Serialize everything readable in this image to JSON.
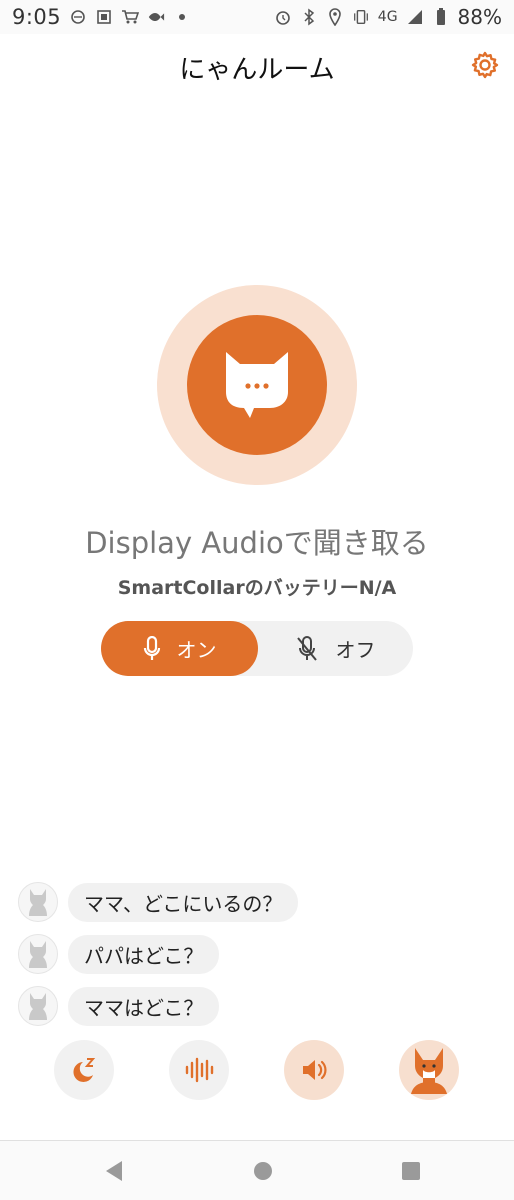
{
  "status_bar": {
    "time": "9:05",
    "network": "4G",
    "battery": "88%",
    "icons": [
      "notification-icon",
      "storage-icon",
      "cart-icon",
      "fish-icon",
      "dot-icon",
      "alarm-icon",
      "bluetooth-icon",
      "location-icon",
      "vibrate-icon",
      "signal-icon",
      "battery-icon"
    ]
  },
  "app_bar": {
    "title": "にゃんルーム",
    "settings_icon": "gear-icon"
  },
  "main": {
    "listen_title": "Display Audioで聞き取る",
    "battery_text": "SmartCollarのバッテリーN/A",
    "toggle": {
      "on_label": "オン",
      "off_label": "オフ",
      "selected": "on"
    }
  },
  "chat": {
    "messages": [
      {
        "text": "ママ、どこにいるの？"
      },
      {
        "text": "パパはどこ？"
      },
      {
        "text": "ママはどこ？"
      }
    ]
  },
  "actions": [
    {
      "icon": "sleep-moon-icon"
    },
    {
      "icon": "sound-wave-icon"
    },
    {
      "icon": "speaker-icon"
    },
    {
      "icon": "fox-avatar-icon"
    }
  ],
  "colors": {
    "accent": "#e0702b",
    "accent_light": "#f9e0d0",
    "bubble_bg": "#f1f1f1"
  }
}
